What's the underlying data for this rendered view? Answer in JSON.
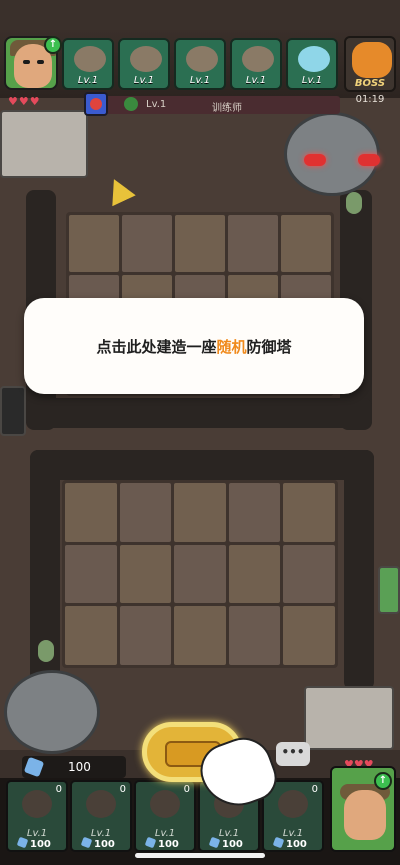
{
  "hero": {
    "level_icon": "upgrade-arrow-icon",
    "hearts": "♥♥♥"
  },
  "tower_bar": {
    "slots": [
      {
        "name": "snail-tower",
        "level": "Lv.1"
      },
      {
        "name": "spring-tower",
        "level": "Lv.1"
      },
      {
        "name": "catapult-tower",
        "level": "Lv.1"
      },
      {
        "name": "robot-tower",
        "level": "Lv.1"
      },
      {
        "name": "crystal-tower",
        "level": "Lv.1"
      }
    ]
  },
  "boss": {
    "label": "BOSS",
    "timer": "01:19"
  },
  "opponent": {
    "level": "Lv.1",
    "role": "训练师"
  },
  "tutorial": {
    "prefix": "点击此处建造一座",
    "highlight": "随机",
    "suffix": "防御塔"
  },
  "resources": {
    "gems": "100"
  },
  "chat": {
    "label": "•••"
  },
  "cards": [
    {
      "count": "0",
      "level": "Lv.1",
      "cost": "100"
    },
    {
      "count": "0",
      "level": "Lv.1",
      "cost": "100"
    },
    {
      "count": "0",
      "level": "Lv.1",
      "cost": "100"
    },
    {
      "count": "0",
      "level": "Lv.1",
      "cost": "100"
    },
    {
      "count": "0",
      "level": "Lv.1",
      "cost": "100"
    }
  ],
  "player_hero": {
    "hearts": "♥♥♥"
  },
  "colors": {
    "accent": "#f08a1c",
    "hero_bg": "#56a14a",
    "tower_bg": "#2b6f52"
  }
}
